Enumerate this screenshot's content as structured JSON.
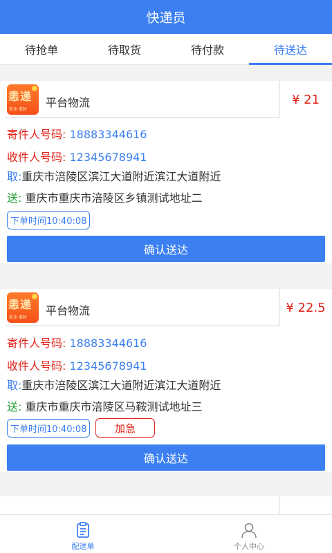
{
  "header": {
    "title": "快递员"
  },
  "tabs": [
    {
      "label": "待抢单"
    },
    {
      "label": "待取货"
    },
    {
      "label": "待付款"
    },
    {
      "label": "待送达"
    }
  ],
  "active_tab": 3,
  "orders": [
    {
      "logo_text": "恚递",
      "logo_slogan": "安全·准时",
      "platform": "平台物流",
      "price": "¥ 21",
      "sender_label": "寄件人号码:",
      "sender_phone": "18883344616",
      "receiver_label": "收件人号码:",
      "receiver_phone": "12345678941",
      "pickup_label": "取:",
      "pickup_address": "重庆市涪陵区滨江大道附近滨江大道附近",
      "deliver_label": "送:",
      "deliver_address": "重庆市重庆市涪陵区乡镇测试地址二",
      "order_time": "下单时间10:40:08",
      "confirm_label": "确认送达"
    },
    {
      "logo_text": "恚递",
      "logo_slogan": "安全·准时",
      "platform": "平台物流",
      "price": "¥ 22.5",
      "sender_label": "寄件人号码:",
      "sender_phone": "18883344616",
      "receiver_label": "收件人号码:",
      "receiver_phone": "12345678941",
      "pickup_label": "取:",
      "pickup_address": "重庆市涪陵区滨江大道附近滨江大道附近",
      "deliver_label": "送:",
      "deliver_address": "重庆市重庆市涪陵区马鞍测试地址三",
      "order_time": "下单时间10:40:08",
      "urgent_label": "加急",
      "confirm_label": "确认送达"
    }
  ],
  "bottom_nav": [
    {
      "label": "配送单",
      "icon": "clipboard-icon"
    },
    {
      "label": "个人中心",
      "icon": "person-icon"
    }
  ],
  "colors": {
    "primary": "#3b7ff0",
    "red": "#e2241c",
    "green": "#28a23a"
  }
}
